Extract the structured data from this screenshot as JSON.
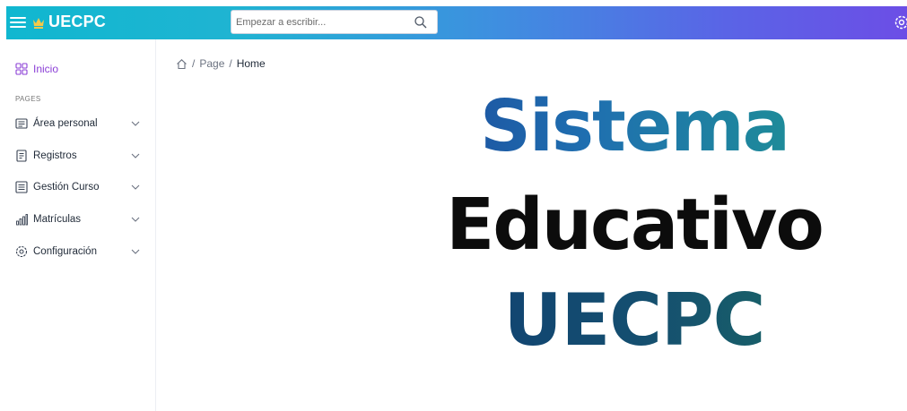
{
  "header": {
    "brand": "UECPC",
    "search_placeholder": "Empezar a escribir..."
  },
  "sidebar": {
    "home_label": "Inicio",
    "section_label": "PAGES",
    "items": [
      {
        "label": "Área personal",
        "icon": "id-card-icon"
      },
      {
        "label": "Registros",
        "icon": "document-icon"
      },
      {
        "label": "Gestión Curso",
        "icon": "list-icon"
      },
      {
        "label": "Matrículas",
        "icon": "bar-chart-icon"
      },
      {
        "label": "Configuración",
        "icon": "gear-icon"
      }
    ]
  },
  "breadcrumb": {
    "page": "Page",
    "current": "Home"
  },
  "hero": {
    "line1": "Sistema",
    "line2": "Educativo",
    "line3": "UECPC"
  },
  "colors": {
    "topbar_start": "#10b7d0",
    "topbar_end": "#6c4ee6",
    "active_nav": "#8b3fd6"
  }
}
